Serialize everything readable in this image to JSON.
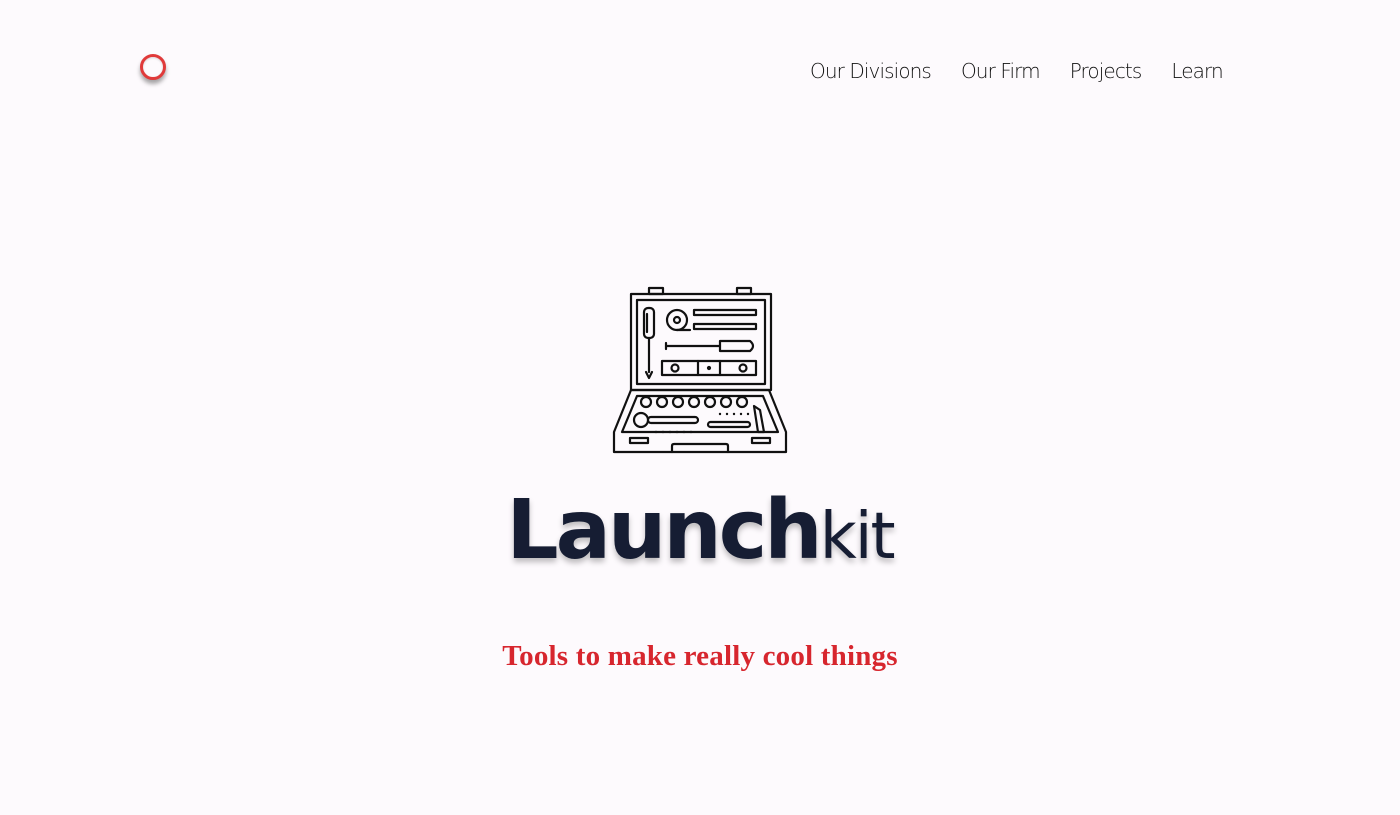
{
  "header": {
    "logo_icon": "ring-logo-icon",
    "nav": [
      {
        "label": "Our Divisions"
      },
      {
        "label": "Our Firm"
      },
      {
        "label": "Projects"
      },
      {
        "label": "Learn"
      }
    ]
  },
  "hero": {
    "illustration_icon": "toolbox-icon",
    "brand_bold": "Launch",
    "brand_light": "kit",
    "tagline": "Tools to make really cool things"
  },
  "colors": {
    "background": "#fdfafd",
    "brand_navy": "#161d33",
    "accent_red": "#d7262e"
  }
}
